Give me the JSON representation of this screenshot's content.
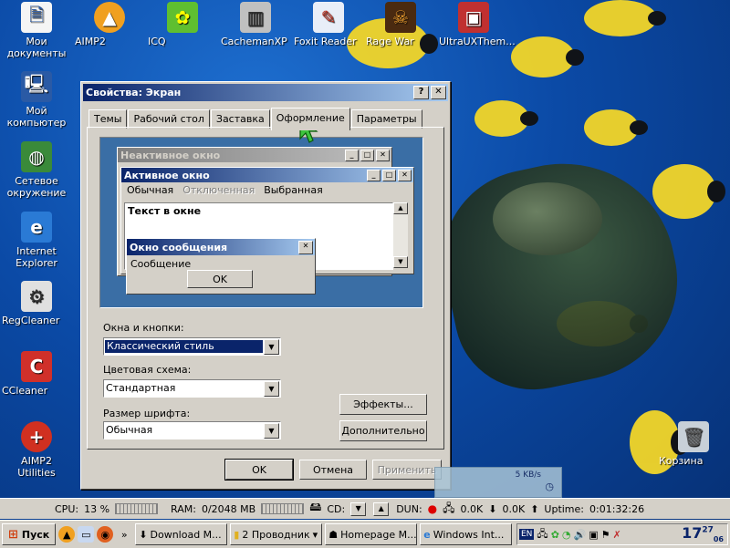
{
  "desktop_icons": [
    {
      "label": "Мои документы",
      "icon": "my-documents-icon"
    },
    {
      "label": "AIMP2",
      "icon": "aimp2-icon"
    },
    {
      "label": "ICQ",
      "icon": "icq-icon"
    },
    {
      "label": "CachemanXP",
      "icon": "cachemanxp-icon"
    },
    {
      "label": "Foxit Reader",
      "icon": "foxit-reader-icon"
    },
    {
      "label": "Rage War",
      "icon": "rage-war-icon"
    },
    {
      "label": "UltraUXThem...",
      "icon": "ultrauxtheme-icon"
    },
    {
      "label": "Мой компьютер",
      "icon": "my-computer-icon"
    },
    {
      "label": "Сетевое окружение",
      "icon": "network-icon"
    },
    {
      "label": "Internet Explorer",
      "icon": "ie-icon"
    },
    {
      "label": "RegCleaner",
      "icon": "regcleaner-icon"
    },
    {
      "label": "CCleaner",
      "icon": "ccleaner-icon"
    },
    {
      "label": "AIMP2 Utilities",
      "icon": "aimp2-utilities-icon"
    },
    {
      "label": "Корзина",
      "icon": "recycle-bin-icon"
    }
  ],
  "dialog": {
    "title": "Свойства: Экран",
    "help_btn": "?",
    "close_btn": "✕",
    "tabs": [
      "Темы",
      "Рабочий стол",
      "Заставка",
      "Оформление",
      "Параметры"
    ],
    "active_tab": "Оформление",
    "preview": {
      "inactive_title": "Неактивное окно",
      "active_title": "Активное окно",
      "menu": [
        "Обычная",
        "Отключенная",
        "Выбранная"
      ],
      "window_text": "Текст в окне",
      "msg_title": "Окно сообщения",
      "msg_text": "Сообщение",
      "msg_ok": "OK"
    },
    "windows_buttons_label": "Окна и кнопки:",
    "windows_buttons_value": "Классический стиль",
    "color_scheme_label": "Цветовая схема:",
    "color_scheme_value": "Стандартная",
    "font_size_label": "Размер шрифта:",
    "font_size_value": "Обычная",
    "effects_btn": "Эффекты...",
    "advanced_btn": "Дополнительно",
    "ok_btn": "OK",
    "cancel_btn": "Отмена",
    "apply_btn": "Применить"
  },
  "status_bar": {
    "cpu_label": "CPU:",
    "cpu_value": "13 %",
    "ram_label": "RAM:",
    "ram_value": "0/2048 MB",
    "cd_label": "CD:",
    "dun_label": "DUN:",
    "down_value": "0.0K",
    "up_value": "0.0K",
    "uptime_label": "Uptime:",
    "uptime_value": "0:01:32:26"
  },
  "net_popup": "5 KB/s",
  "taskbar": {
    "start_label": "Пуск",
    "tasks": [
      "Download M...",
      "2 Проводник",
      "Homepage M...",
      "Windows Int..."
    ],
    "lang": "EN",
    "clock_hour": "17",
    "clock_min": "27",
    "clock_sec": "06"
  },
  "colors": {
    "title_active": "#0a246a",
    "title_gradient_end": "#a6caf0",
    "title_inactive": "#808080",
    "window_face": "#d4d0c8",
    "desktop": "#3a6ea5"
  }
}
